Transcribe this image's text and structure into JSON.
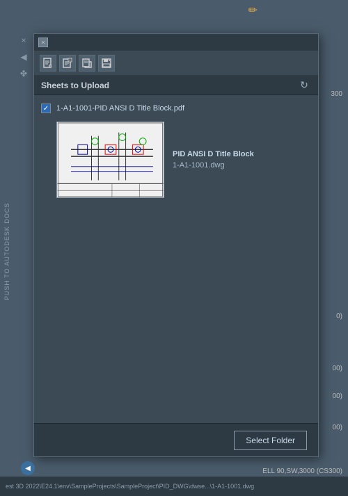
{
  "background": {
    "color": "#4a5c6b"
  },
  "pencil_icon": "✏",
  "dialog": {
    "close_btn_label": "×",
    "toolbar": {
      "btn1_icon": "📄",
      "btn2_icon": "📋",
      "btn3_icon": "📤",
      "btn4_icon": "💾"
    },
    "section": {
      "title": "Sheets to Upload",
      "refresh_icon": "↻"
    },
    "file_item": {
      "name": "1-A1-1001-PID ANSI D Title Block.pdf",
      "checked": true,
      "check_icon": "✓"
    },
    "file_info": {
      "title": "PID ANSI D Title Block",
      "subtitle": "1-A1-1001.dwg"
    },
    "footer": {
      "select_folder_label": "Select Folder"
    }
  },
  "right_panel": {
    "item_300": "300",
    "item_0": "0)",
    "item_00_1": "00)",
    "item_00_2": "00)",
    "item_00_3": "00)",
    "bottom_item": "ELL 90,SW,3000 (CS300)"
  },
  "bottom_bar": {
    "text1": "est  3D  2022\\E24.1\\env\\SampleProjects\\SampleProject\\PID_DWG\\dwse...\\1-A1-1001.dwg"
  },
  "vertical_label": "PUSH TO AUTODESK DOCS",
  "sidebar": {
    "icon1": "×",
    "icon2": "◀",
    "icon3": "✤"
  }
}
